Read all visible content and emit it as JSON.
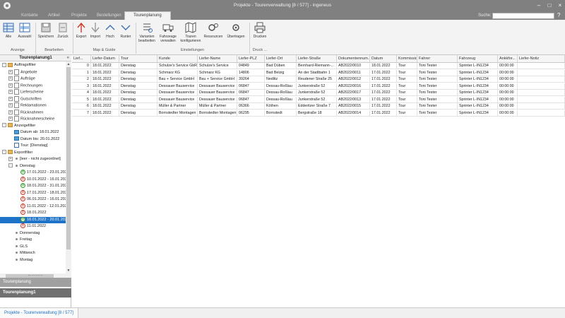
{
  "window": {
    "title": "Projekte - Tourenverwaltung [8 / 577] - ingeneus"
  },
  "tabs": [
    {
      "label": "Kontakte"
    },
    {
      "label": "Artikel"
    },
    {
      "label": "Projekte"
    },
    {
      "label": "Bestellungen"
    },
    {
      "label": "Tourenplanung",
      "active": true
    }
  ],
  "search": {
    "label": "Suche:",
    "value": ""
  },
  "toolbar": {
    "buttons": [
      {
        "label": "Alle"
      },
      {
        "label": "Auswahl"
      },
      {
        "label": "Speichern"
      },
      {
        "label": "Zurück"
      },
      {
        "label": "Export"
      },
      {
        "label": "Import"
      },
      {
        "label": "Hoch"
      },
      {
        "label": "Runter"
      },
      {
        "label": "Varianten bearbeiten"
      },
      {
        "label": "Fahrzeuge verwalten"
      },
      {
        "label": "Touren konfigurieren"
      },
      {
        "label": "Ressourcen"
      },
      {
        "label": "Übertragen"
      },
      {
        "label": "Drucken"
      }
    ],
    "groups": [
      "Anzeige",
      "Bearbeiten",
      "Map & Guide",
      "Einstellungen",
      "Druck ..."
    ]
  },
  "left_panel": {
    "title": "Tourenplanung1",
    "tree": [
      {
        "label": "Auftragsfilter",
        "type": "folder",
        "expand": "-",
        "level": 0
      },
      {
        "label": "Angebote",
        "type": "doc",
        "expand": "+",
        "level": 1
      },
      {
        "label": "Aufträge",
        "type": "doc",
        "expand": "+",
        "level": 1
      },
      {
        "label": "Rechnungen",
        "type": "doc",
        "expand": "+",
        "level": 1
      },
      {
        "label": "Lieferscheine",
        "type": "doc",
        "expand": "+",
        "level": 1
      },
      {
        "label": "Gutschriften",
        "type": "doc",
        "expand": "+",
        "level": 1
      },
      {
        "label": "Reklamationen",
        "type": "doc",
        "expand": "+",
        "level": 1
      },
      {
        "label": "Rücknahmen",
        "type": "doc",
        "expand": "+",
        "level": 1
      },
      {
        "label": "Rücknahmescheine",
        "type": "doc",
        "expand": "+",
        "level": 1
      },
      {
        "label": "Anzeigefilter",
        "type": "folder",
        "expand": "-",
        "level": 0
      },
      {
        "label": "Datum ab: 18.01.2022",
        "type": "filter",
        "level": 1
      },
      {
        "label": "Datum bis: 20.01.2022",
        "type": "filter",
        "level": 1
      },
      {
        "label": "Tour: [Dienstag]",
        "type": "cal",
        "level": 1
      },
      {
        "label": "Exportfilter",
        "type": "folder",
        "expand": "-",
        "level": 0
      },
      {
        "label": "[leer - nicht zugeordnet]",
        "type": "dot",
        "expand": "+",
        "level": 1
      },
      {
        "label": "Dienstag",
        "type": "dot",
        "expand": "-",
        "level": 1
      },
      {
        "label": "17.01.2022 - 23.01.2022",
        "type": "green",
        "glyph": "Λ",
        "level": 2
      },
      {
        "label": "10.01.2022 - 16.01.2022",
        "type": "red",
        "glyph": "T",
        "level": 2
      },
      {
        "label": "18.01.2022 - 31.01.2022",
        "type": "green",
        "glyph": "Λ",
        "level": 2
      },
      {
        "label": "17.01.2022 - 18.01.2022",
        "type": "red",
        "glyph": "T",
        "level": 2
      },
      {
        "label": "06.01.2022 - 16.01.2022",
        "type": "red",
        "glyph": "T",
        "level": 2
      },
      {
        "label": "11.01.2022 - 12.01.2022",
        "type": "red",
        "glyph": "T",
        "level": 2
      },
      {
        "label": "18.01.2022",
        "type": "red",
        "glyph": "T",
        "level": 2
      },
      {
        "label": "18.01.2022 - 20.01.2022",
        "type": "green",
        "glyph": "Λ",
        "level": 2,
        "selected": true
      },
      {
        "label": "11.01.2022",
        "type": "red",
        "glyph": "T",
        "level": 2
      },
      {
        "label": "Donnerstag",
        "type": "dot",
        "level": 1
      },
      {
        "label": "Freitag",
        "type": "dot",
        "level": 1
      },
      {
        "label": "GLS",
        "type": "dot",
        "level": 1
      },
      {
        "label": "Mittwoch",
        "type": "dot",
        "level": 1
      },
      {
        "label": "Montag",
        "type": "dot",
        "level": 1
      }
    ],
    "nav": [
      {
        "label": "Tourenplanung"
      },
      {
        "label": "Tourenplanung1"
      }
    ]
  },
  "grid": {
    "columns": [
      {
        "label": "Lief...",
        "w": 27
      },
      {
        "label": "Liefer-Datum",
        "w": 40
      },
      {
        "label": "Tour",
        "w": 54
      },
      {
        "label": "Kunde",
        "w": 57
      },
      {
        "label": "Liefer-Name",
        "w": 56
      },
      {
        "label": "Liefer-PLZ",
        "w": 39
      },
      {
        "label": "Liefer-Ort",
        "w": 45
      },
      {
        "label": "Liefer-Straße",
        "w": 57
      },
      {
        "label": "Dokumentennum...",
        "w": 47
      },
      {
        "label": "Datum",
        "w": 38
      },
      {
        "label": "Kommission",
        "w": 29
      },
      {
        "label": "Fahrer",
        "w": 57
      },
      {
        "label": "Fahrzeug",
        "w": 57
      },
      {
        "label": "Ankkfor...",
        "w": 28
      },
      {
        "label": "Liefer-Notiz",
        "w": 67
      }
    ],
    "rows": [
      [
        "0",
        "18.01.2022",
        "Dienstag",
        "Schulze's Service GbR",
        "Schulze's Service",
        "04849",
        "Bad Düben",
        "Bernhard-Riemann-...",
        "AB2022/0010",
        "18.01.2022",
        "Tour",
        "Toni Tester",
        "Sprinter L-IN1234",
        "00:00:00",
        ""
      ],
      [
        "1",
        "18.01.2022",
        "Dienstag",
        "Schmarz KG",
        "Schmarz KG",
        "14806",
        "Bad Belzig",
        "An der Stadtbahn 1",
        "AB2022/0011",
        "17.01.2022",
        "Tour",
        "Toni Tester",
        "Sprinter L-IN1234",
        "00:00:00",
        ""
      ],
      [
        "2",
        "18.01.2022",
        "Dienstag",
        "Bau + Service GmbH",
        "Bau + Service GmbH",
        "39264",
        "Nedlitz",
        "Reudener Straße 25",
        "AB2022/0012",
        "17.01.2022",
        "Tour",
        "Toni Tester",
        "Sprinter L-IN1234",
        "00:00:00",
        ""
      ],
      [
        "3",
        "18.01.2022",
        "Dienstag",
        "Dessauer Bauservice",
        "Dessauer Bauservice",
        "06847",
        "Dessau-Roßlau",
        "Junkerstraße 52",
        "AB2022/0016",
        "17.01.2022",
        "Tour",
        "Toni Tester",
        "Sprinter L-IN1234",
        "00:00:00",
        ""
      ],
      [
        "4",
        "18.01.2022",
        "Dienstag",
        "Dessauer Bauservice",
        "Dessauer Bauservice",
        "06847",
        "Dessau-Roßlau",
        "Junkerstraße 52",
        "AB2022/0017",
        "17.01.2022",
        "Tour",
        "Toni Tester",
        "Sprinter L-IN1234",
        "00:00:00",
        ""
      ],
      [
        "5",
        "18.01.2022",
        "Dienstag",
        "Dessauer Bauservice",
        "Dessauer Bauservice",
        "06847",
        "Dessau-Roßlau",
        "Junkerstraße 52",
        "AB2022/0013",
        "17.01.2022",
        "Tour",
        "Toni Tester",
        "Sprinter L-IN1234",
        "00:00:00",
        ""
      ],
      [
        "6",
        "18.01.2022",
        "Dienstag",
        "Müller & Partner",
        "Müller & Partner",
        "06366",
        "Köthen",
        "Edderitzer Straße 7",
        "AB2022/0015",
        "17.01.2022",
        "Tour",
        "Toni Tester",
        "Sprinter L-IN1234",
        "00:00:00",
        ""
      ],
      [
        "7",
        "18.01.2022",
        "Dienstag",
        "Bornstedter Montagen",
        "Bornstedter Montagen",
        "06295",
        "Bornstedt",
        "Bergstraße 18",
        "AB2022/0014",
        "17.01.2022",
        "Tour",
        "Toni Tester",
        "Sprinter L-IN1234",
        "00:00:00",
        ""
      ]
    ]
  },
  "status": {
    "text": "Projekte - Tourenverwaltung [8 / 577]"
  },
  "colors": {
    "selection": "#1e73c8",
    "titlebar": "#808080",
    "status_link": "#1e6fc0"
  }
}
